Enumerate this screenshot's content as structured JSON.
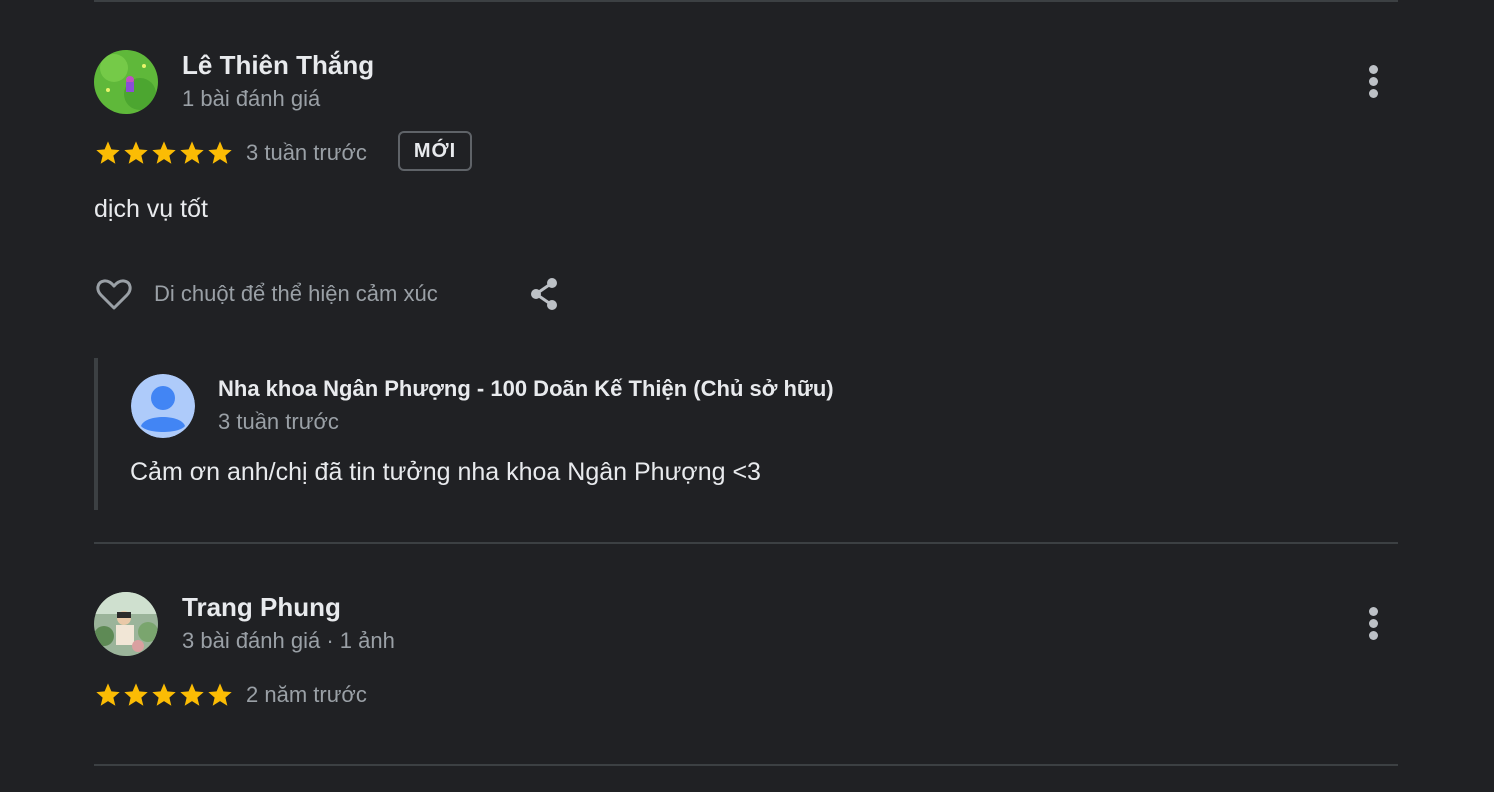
{
  "colors": {
    "background": "#202124",
    "star": "#fbbc04",
    "text_primary": "#e8eaed",
    "text_secondary": "#9aa0a6",
    "divider": "#3c4043",
    "owner_avatar_bg": "#aecbfa",
    "owner_avatar_fg": "#4285f4"
  },
  "reviews": [
    {
      "name": "Lê Thiên Thắng",
      "meta": "1 bài đánh giá",
      "rating": 5,
      "date": "3 tuần trước",
      "badge": "MỚI",
      "text": "dịch vụ tốt",
      "reaction_hint": "Di chuột để thể hiện cảm xúc",
      "icons": {
        "like": "heart-outline-icon",
        "share": "share-icon",
        "more": "more-vertical-icon"
      },
      "owner_reply": {
        "name": "Nha khoa Ngân Phượng - 100 Doãn Kế Thiện (Chủ sở hữu)",
        "date": "3 tuần trước",
        "text": "Cảm ơn anh/chị đã tin tưởng nha khoa Ngân Phượng <3"
      }
    },
    {
      "name": "Trang Phung",
      "meta": "3 bài đánh giá · 1 ảnh",
      "rating": 5,
      "date": "2 năm trước",
      "icons": {
        "more": "more-vertical-icon"
      }
    }
  ]
}
